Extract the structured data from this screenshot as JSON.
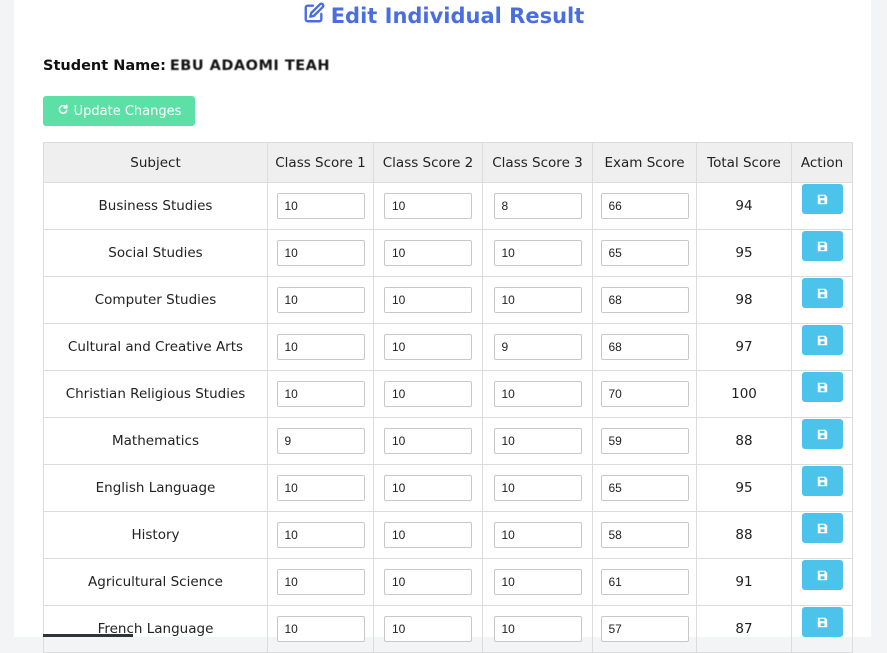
{
  "page": {
    "title": "Edit Individual Result",
    "accent_color": "#4a6ee0"
  },
  "student": {
    "label": "Student Name:",
    "name": "EBU ADAOMI TEAH"
  },
  "update_button": {
    "label": "Update Changes",
    "icon": "refresh-icon",
    "color": "#5ce0a6"
  },
  "table": {
    "headers": [
      "Subject",
      "Class Score 1",
      "Class Score 2",
      "Class Score 3",
      "Exam Score",
      "Total Score",
      "Action"
    ],
    "rows": [
      {
        "subject": "Business Studies",
        "cs1": "10",
        "cs2": "10",
        "cs3": "8",
        "exam": "66",
        "total": "94"
      },
      {
        "subject": "Social Studies",
        "cs1": "10",
        "cs2": "10",
        "cs3": "10",
        "exam": "65",
        "total": "95"
      },
      {
        "subject": "Computer Studies",
        "cs1": "10",
        "cs2": "10",
        "cs3": "10",
        "exam": "68",
        "total": "98"
      },
      {
        "subject": "Cultural and Creative Arts",
        "cs1": "10",
        "cs2": "10",
        "cs3": "9",
        "exam": "68",
        "total": "97"
      },
      {
        "subject": "Christian Religious Studies",
        "cs1": "10",
        "cs2": "10",
        "cs3": "10",
        "exam": "70",
        "total": "100"
      },
      {
        "subject": "Mathematics",
        "cs1": "9",
        "cs2": "10",
        "cs3": "10",
        "exam": "59",
        "total": "88"
      },
      {
        "subject": "English Language",
        "cs1": "10",
        "cs2": "10",
        "cs3": "10",
        "exam": "65",
        "total": "95"
      },
      {
        "subject": "History",
        "cs1": "10",
        "cs2": "10",
        "cs3": "10",
        "exam": "58",
        "total": "88"
      },
      {
        "subject": "Agricultural Science",
        "cs1": "10",
        "cs2": "10",
        "cs3": "10",
        "exam": "61",
        "total": "91"
      },
      {
        "subject": "French Language",
        "cs1": "10",
        "cs2": "10",
        "cs3": "10",
        "exam": "57",
        "total": "87"
      }
    ],
    "save_icon": "save-icon",
    "save_color": "#4cc3ea"
  }
}
